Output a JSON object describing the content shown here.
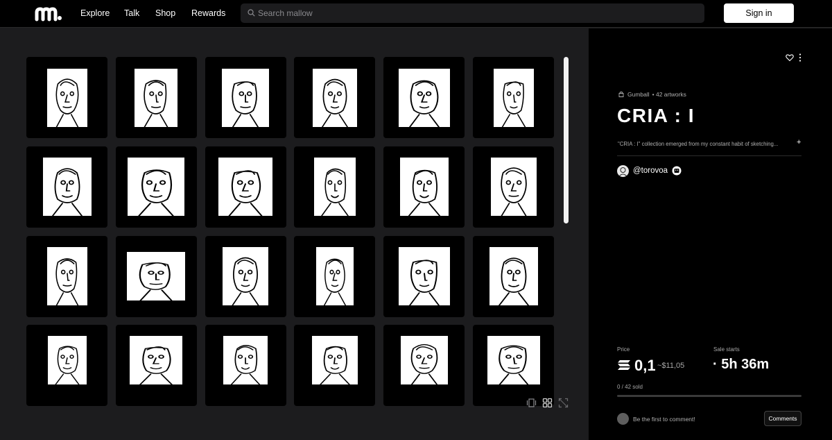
{
  "header": {
    "logo_icon": "mallow-logo-icon",
    "nav": [
      {
        "label": "Explore"
      },
      {
        "label": "Talk"
      },
      {
        "label": "Shop"
      },
      {
        "label": "Rewards"
      }
    ],
    "search": {
      "placeholder": "Search mallow",
      "icon": "search-icon"
    },
    "signin_label": "Sign in"
  },
  "gallery": {
    "artworks_shown": 24,
    "view_icons": [
      "carousel-view-icon",
      "grid-view-icon",
      "fullscreen-icon"
    ]
  },
  "collection": {
    "platform": "Gumball",
    "artwork_count": "• 42 artworks",
    "title": "CRIA : I",
    "description": "\"CRIA : I\" collection emerged from my constant habit of sketching...",
    "expand": "+",
    "creator": "@torovoa",
    "price_label": "Price",
    "price": "0,1",
    "price_usd": "~$11,05",
    "sale_label": "Sale starts",
    "sale_countdown": "· 5h 36m",
    "sold": "0 / 42 sold",
    "sold_fraction": 0,
    "comment_prompt": "Be the first to comment!",
    "comments_label": "Comments"
  },
  "colors": {
    "background": "#1c1c1e",
    "panel": "#000000",
    "accent": "#ffffff"
  }
}
